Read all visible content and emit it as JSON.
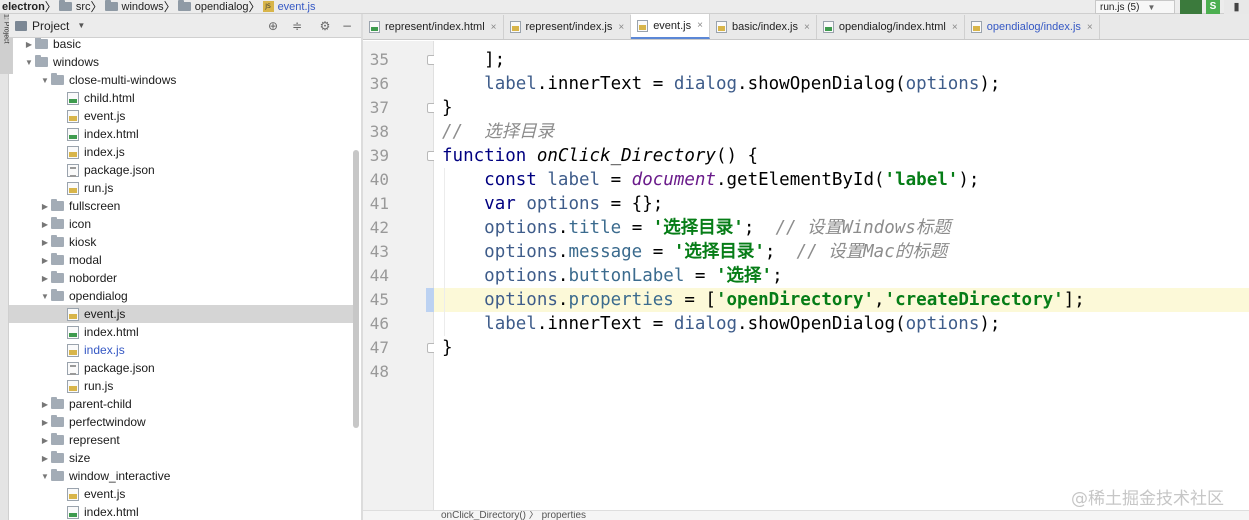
{
  "breadcrumb": [
    "electron",
    "src",
    "windows",
    "opendialog",
    "event.js"
  ],
  "run_config": {
    "label": "run.js (5)"
  },
  "run_button": {
    "badge": "S"
  },
  "side_tab": {
    "label": "1: Project"
  },
  "project_panel": {
    "title": "Project",
    "tree": [
      {
        "label": "basic",
        "type": "folder",
        "depth": 1,
        "expanded": false
      },
      {
        "label": "windows",
        "type": "folder",
        "depth": 1,
        "expanded": true
      },
      {
        "label": "close-multi-windows",
        "type": "folder",
        "depth": 2,
        "expanded": true
      },
      {
        "label": "child.html",
        "type": "html",
        "depth": 3
      },
      {
        "label": "event.js",
        "type": "js",
        "depth": 3
      },
      {
        "label": "index.html",
        "type": "html",
        "depth": 3
      },
      {
        "label": "index.js",
        "type": "js",
        "depth": 3
      },
      {
        "label": "package.json",
        "type": "json",
        "depth": 3
      },
      {
        "label": "run.js",
        "type": "js",
        "depth": 3
      },
      {
        "label": "fullscreen",
        "type": "folder",
        "depth": 2,
        "expanded": false
      },
      {
        "label": "icon",
        "type": "folder",
        "depth": 2,
        "expanded": false
      },
      {
        "label": "kiosk",
        "type": "folder",
        "depth": 2,
        "expanded": false
      },
      {
        "label": "modal",
        "type": "folder",
        "depth": 2,
        "expanded": false
      },
      {
        "label": "noborder",
        "type": "folder",
        "depth": 2,
        "expanded": false
      },
      {
        "label": "opendialog",
        "type": "folder",
        "depth": 2,
        "expanded": true
      },
      {
        "label": "event.js",
        "type": "js",
        "depth": 3,
        "selected": true
      },
      {
        "label": "index.html",
        "type": "html",
        "depth": 3
      },
      {
        "label": "index.js",
        "type": "js",
        "depth": 3,
        "modified": true
      },
      {
        "label": "package.json",
        "type": "json",
        "depth": 3
      },
      {
        "label": "run.js",
        "type": "js",
        "depth": 3
      },
      {
        "label": "parent-child",
        "type": "folder",
        "depth": 2,
        "expanded": false
      },
      {
        "label": "perfectwindow",
        "type": "folder",
        "depth": 2,
        "expanded": false
      },
      {
        "label": "represent",
        "type": "folder",
        "depth": 2,
        "expanded": false
      },
      {
        "label": "size",
        "type": "folder",
        "depth": 2,
        "expanded": false
      },
      {
        "label": "window_interactive",
        "type": "folder",
        "depth": 2,
        "expanded": true
      },
      {
        "label": "event.js",
        "type": "js",
        "depth": 3
      },
      {
        "label": "index.html",
        "type": "html",
        "depth": 3
      }
    ]
  },
  "tabs": [
    {
      "label": "represent/index.html",
      "type": "html"
    },
    {
      "label": "represent/index.js",
      "type": "js"
    },
    {
      "label": "event.js",
      "type": "js",
      "active": true
    },
    {
      "label": "basic/index.js",
      "type": "js"
    },
    {
      "label": "opendialog/index.html",
      "type": "html"
    },
    {
      "label": "opendialog/index.js",
      "type": "js",
      "modified": true
    }
  ],
  "editor": {
    "current_line": 45,
    "lines": [
      {
        "n": "35",
        "tokens": [
          [
            "    ];",
            ""
          ]
        ]
      },
      {
        "n": "36",
        "tokens": [
          [
            "    ",
            ""
          ],
          [
            "label",
            "var"
          ],
          [
            ".innerText = ",
            ""
          ],
          [
            "dialog",
            "var"
          ],
          [
            ".showOpenDialog(",
            ""
          ],
          [
            "options",
            "var"
          ],
          [
            ");",
            ""
          ]
        ]
      },
      {
        "n": "37",
        "tokens": [
          [
            "}",
            ""
          ]
        ]
      },
      {
        "n": "38",
        "tokens": [
          [
            "//  选择目录",
            "com"
          ]
        ]
      },
      {
        "n": "39",
        "tokens": [
          [
            "function ",
            "kw"
          ],
          [
            "onClick_Directory",
            "fn"
          ],
          [
            "() {",
            ""
          ]
        ]
      },
      {
        "n": "40",
        "tokens": [
          [
            "    ",
            ""
          ],
          [
            "const ",
            "kw"
          ],
          [
            "label",
            "var"
          ],
          [
            " = ",
            ""
          ],
          [
            "document",
            "glob"
          ],
          [
            ".getElementById(",
            ""
          ],
          [
            "'label'",
            "str"
          ],
          [
            ");",
            ""
          ]
        ]
      },
      {
        "n": "41",
        "tokens": [
          [
            "    ",
            ""
          ],
          [
            "var ",
            "kw"
          ],
          [
            "options",
            "var"
          ],
          [
            " = {};",
            ""
          ]
        ]
      },
      {
        "n": "42",
        "tokens": [
          [
            "    ",
            ""
          ],
          [
            "options",
            "var"
          ],
          [
            ".",
            ""
          ],
          [
            "title",
            "m"
          ],
          [
            " = ",
            ""
          ],
          [
            "'选择目录'",
            "str"
          ],
          [
            ";  ",
            ""
          ],
          [
            "// 设置Windows标题",
            "com"
          ]
        ]
      },
      {
        "n": "43",
        "tokens": [
          [
            "    ",
            ""
          ],
          [
            "options",
            "var"
          ],
          [
            ".",
            ""
          ],
          [
            "message",
            "m"
          ],
          [
            " = ",
            ""
          ],
          [
            "'选择目录'",
            "str"
          ],
          [
            ";  ",
            ""
          ],
          [
            "// 设置Mac的标题",
            "com"
          ]
        ]
      },
      {
        "n": "44",
        "tokens": [
          [
            "    ",
            ""
          ],
          [
            "options",
            "var"
          ],
          [
            ".",
            ""
          ],
          [
            "buttonLabel",
            "m"
          ],
          [
            " = ",
            ""
          ],
          [
            "'选择'",
            "str"
          ],
          [
            ";",
            ""
          ]
        ]
      },
      {
        "n": "45",
        "tokens": [
          [
            "    ",
            ""
          ],
          [
            "options",
            "var"
          ],
          [
            ".",
            ""
          ],
          [
            "properties",
            "m"
          ],
          [
            " = [",
            ""
          ],
          [
            "'openDirectory'",
            "str"
          ],
          [
            ",",
            ""
          ],
          [
            "'createDirectory'",
            "str"
          ],
          [
            "];",
            ""
          ]
        ]
      },
      {
        "n": "46",
        "tokens": [
          [
            "    ",
            ""
          ],
          [
            "label",
            "var"
          ],
          [
            ".innerText = ",
            ""
          ],
          [
            "dialog",
            "var"
          ],
          [
            ".showOpenDialog(",
            ""
          ],
          [
            "options",
            "var"
          ],
          [
            ");",
            ""
          ]
        ]
      },
      {
        "n": "47",
        "tokens": [
          [
            "}",
            ""
          ]
        ]
      },
      {
        "n": "48",
        "tokens": []
      }
    ]
  },
  "status_bar": {
    "breadcrumb": "onClick_Directory()  〉  properties"
  },
  "watermark": "@稀土掘金技术社区"
}
